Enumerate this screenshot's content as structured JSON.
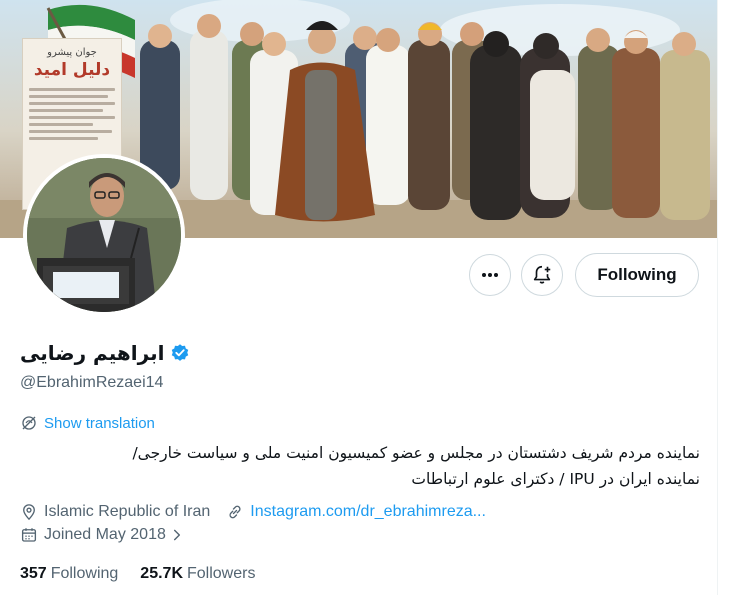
{
  "banner": {
    "poster_line1": "جوان پیشرو",
    "poster_line2": "دلیل امید"
  },
  "actions": {
    "more_label": "•••",
    "following_label": "Following"
  },
  "profile": {
    "display_name": "ابراهیم رضایی",
    "handle": "@EbrahimRezaei14",
    "verified": true,
    "show_translation": "Show translation",
    "bio_line1": "نماینده مردم شریف دشتستان در مجلس و عضو کمیسیون امنیت ملی و سیاست خارجی/",
    "bio_line2": "نماینده ایران در IPU / دکترای علوم ارتباطات",
    "location": "Islamic Republic of Iran",
    "website": "Instagram.com/dr_ebrahimreza...",
    "joined": "Joined May 2018"
  },
  "stats": {
    "following_count": "357",
    "following_label": "Following",
    "followers_count": "25.7K",
    "followers_label": "Followers"
  },
  "colors": {
    "accent": "#1d9bf0",
    "text_primary": "#0f1419",
    "text_secondary": "#536471",
    "border": "#cfd9de"
  },
  "icons": {
    "more": "more-horizontal-icon",
    "notify": "bell-plus-icon",
    "verified": "verified-badge-icon",
    "translate": "translate-globe-icon",
    "location": "location-pin-icon",
    "link": "link-icon",
    "calendar": "calendar-icon",
    "chevron": "chevron-right-icon"
  }
}
